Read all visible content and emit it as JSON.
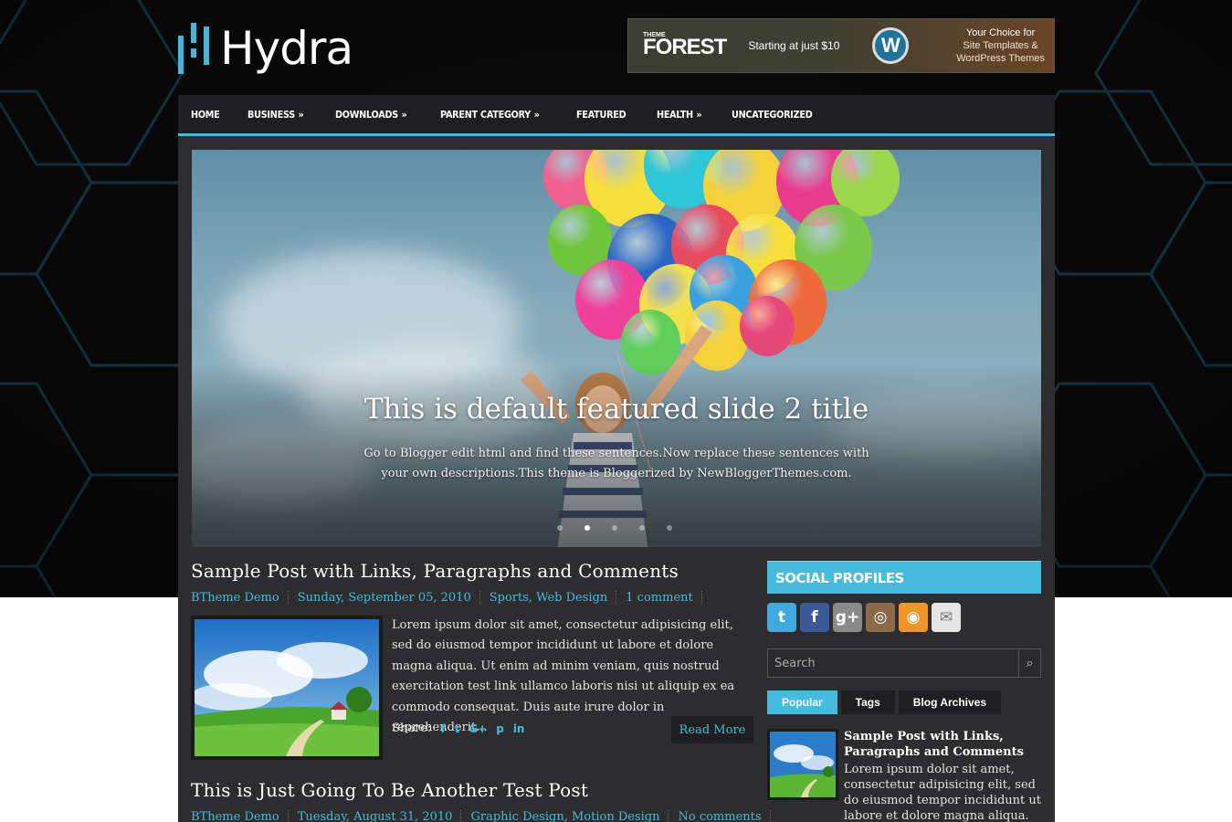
{
  "site": {
    "logo_text": "Hydra"
  },
  "ad": {
    "brand_small": "THEME",
    "brand": "FOREST",
    "starting": "Starting at just $10",
    "wp_badge": "W",
    "right_line1": "Your Choice for",
    "right_line2": "Site Templates &",
    "right_line3": "WordPress Themes"
  },
  "nav": {
    "items": [
      {
        "label": "HOME",
        "arrow": ""
      },
      {
        "label": "BUSINESS",
        "arrow": "»"
      },
      {
        "label": "DOWNLOADS",
        "arrow": "»"
      },
      {
        "label": "PARENT CATEGORY",
        "arrow": "»"
      },
      {
        "label": "FEATURED",
        "arrow": ""
      },
      {
        "label": "HEALTH",
        "arrow": "»"
      },
      {
        "label": "UNCATEGORIZED",
        "arrow": ""
      }
    ]
  },
  "slider": {
    "title": "This is default featured slide 2 title",
    "description": "Go to Blogger edit html and find these sentences.Now replace these sentences with your own descriptions.This theme is Bloggerized by NewBloggerThemes.com.",
    "active_index": 1
  },
  "posts": [
    {
      "title": "Sample Post with Links, Paragraphs and Comments",
      "author": "BTheme Demo",
      "date": "Sunday, September 05, 2010",
      "labels": "Sports, Web Design",
      "comments": "1 comment",
      "excerpt": "Lorem ipsum dolor sit amet, consectetur adipisicing elit, sed do eiusmod tempor incididunt ut labore et dolore magna aliqua. Ut enim ad minim veniam, quis nostrud exercitation test link ullamco laboris nisi ut aliquip ex ea commodo consequat. Duis aute irure dolor in reprehenderit...",
      "share_label": "Share:",
      "read_more": "Read More"
    },
    {
      "title": "This is Just Going To Be Another Test Post",
      "author": "BTheme Demo",
      "date": "Tuesday, August 31, 2010",
      "labels": "Graphic Design, Motion Design",
      "comments": "No comments"
    }
  ],
  "share_icons": [
    "f",
    "t",
    "G+",
    "p",
    "in"
  ],
  "sidebar": {
    "social_title": "SOCIAL PROFILES",
    "social_icons": [
      {
        "name": "twitter-icon",
        "glyph": "t",
        "color": "#3fa9e0"
      },
      {
        "name": "facebook-icon",
        "glyph": "f",
        "color": "#3b5998"
      },
      {
        "name": "google-plus-icon",
        "glyph": "g+",
        "color": "#8a8a8a"
      },
      {
        "name": "instagram-icon",
        "glyph": "◎",
        "color": "#8a6a4a"
      },
      {
        "name": "rss-icon",
        "glyph": "◉",
        "color": "#f0952a"
      },
      {
        "name": "email-icon",
        "glyph": "✉",
        "color": "#e6e6e6"
      }
    ],
    "search_placeholder": "Search",
    "tabs": [
      "Popular",
      "Tags",
      "Blog Archives"
    ],
    "popular": {
      "title": "Sample Post with Links, Paragraphs and Comments",
      "excerpt": "Lorem ipsum dolor sit amet, consectetur adipisicing elit, sed do eiusmod tempor incididunt ut labore et dolore magna aliqua. Ut"
    }
  },
  "colors": {
    "accent": "#45bbdd",
    "nav_bg": "#1f1f21",
    "content_bg": "#2d2d2f"
  }
}
